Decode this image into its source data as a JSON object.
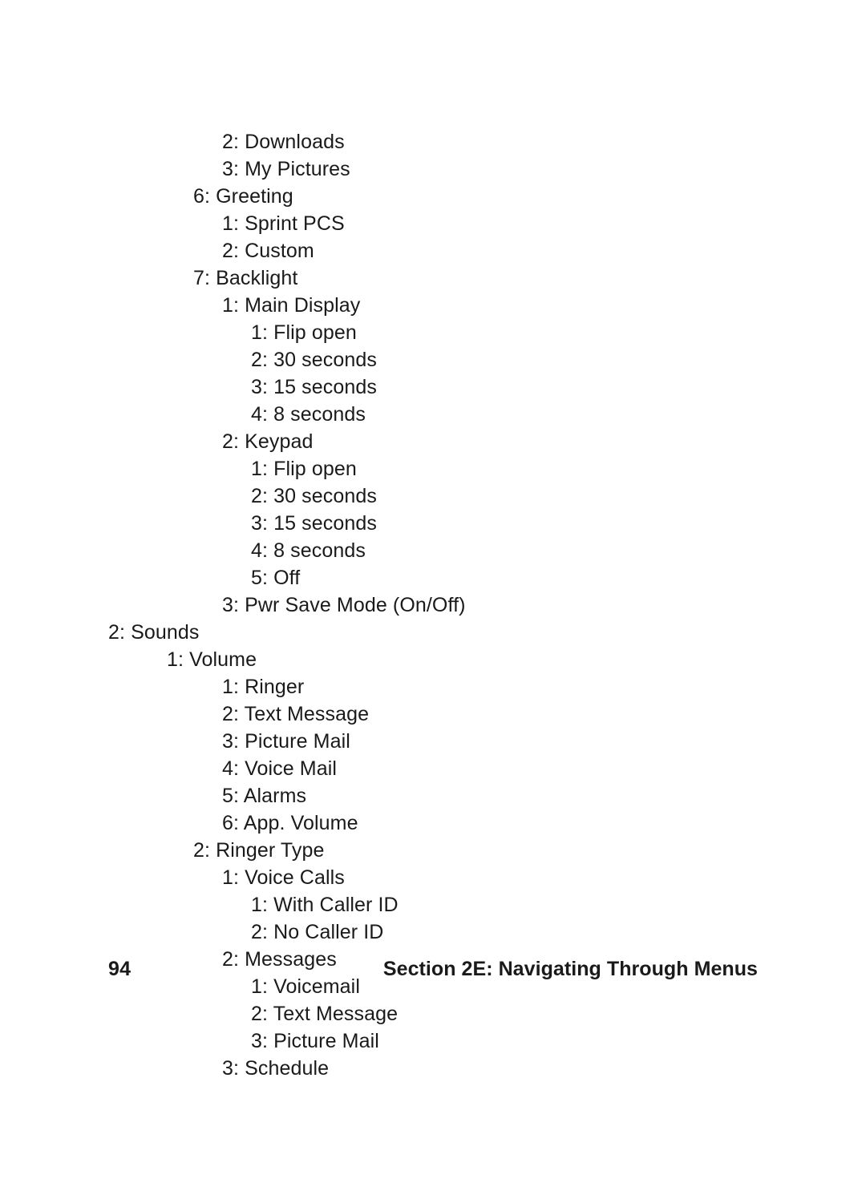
{
  "lines": [
    {
      "indent": 3,
      "text": "2: Downloads"
    },
    {
      "indent": 3,
      "text": "3: My Pictures"
    },
    {
      "indent": 2,
      "text": "6: Greeting"
    },
    {
      "indent": 3,
      "text": "1: Sprint PCS"
    },
    {
      "indent": 3,
      "text": "2: Custom"
    },
    {
      "indent": 2,
      "text": "7: Backlight"
    },
    {
      "indent": 3,
      "text": "1: Main Display"
    },
    {
      "indent": 4,
      "text": "1: Flip open"
    },
    {
      "indent": 4,
      "text": "2: 30 seconds"
    },
    {
      "indent": 4,
      "text": "3: 15 seconds"
    },
    {
      "indent": 4,
      "text": "4: 8 seconds"
    },
    {
      "indent": 3,
      "text": "2: Keypad"
    },
    {
      "indent": 4,
      "text": "1: Flip open"
    },
    {
      "indent": 4,
      "text": "2: 30 seconds"
    },
    {
      "indent": 4,
      "text": "3: 15 seconds"
    },
    {
      "indent": 4,
      "text": "4: 8 seconds"
    },
    {
      "indent": 4,
      "text": "5: Off"
    },
    {
      "indent": 3,
      "text": "3: Pwr Save Mode (On/Off)"
    },
    {
      "indent": 0,
      "text": "2: Sounds"
    },
    {
      "indent": 1,
      "text": "1: Volume"
    },
    {
      "indent": 3,
      "text": "1: Ringer"
    },
    {
      "indent": 3,
      "text": "2: Text Message"
    },
    {
      "indent": 3,
      "text": "3: Picture Mail"
    },
    {
      "indent": 3,
      "text": "4: Voice Mail"
    },
    {
      "indent": 3,
      "text": "5: Alarms"
    },
    {
      "indent": 3,
      "text": "6: App. Volume"
    },
    {
      "indent": 2,
      "text": "2: Ringer Type"
    },
    {
      "indent": 3,
      "text": "1: Voice Calls"
    },
    {
      "indent": 4,
      "text": "1: With Caller ID"
    },
    {
      "indent": 4,
      "text": "2: No Caller ID"
    },
    {
      "indent": 3,
      "text": "2: Messages"
    },
    {
      "indent": 4,
      "text": "1: Voicemail"
    },
    {
      "indent": 4,
      "text": "2: Text Message"
    },
    {
      "indent": 4,
      "text": "3: Picture Mail"
    },
    {
      "indent": 3,
      "text": "3: Schedule"
    }
  ],
  "footer": {
    "page_number": "94",
    "section_title": "Section 2E: Navigating Through Menus"
  }
}
